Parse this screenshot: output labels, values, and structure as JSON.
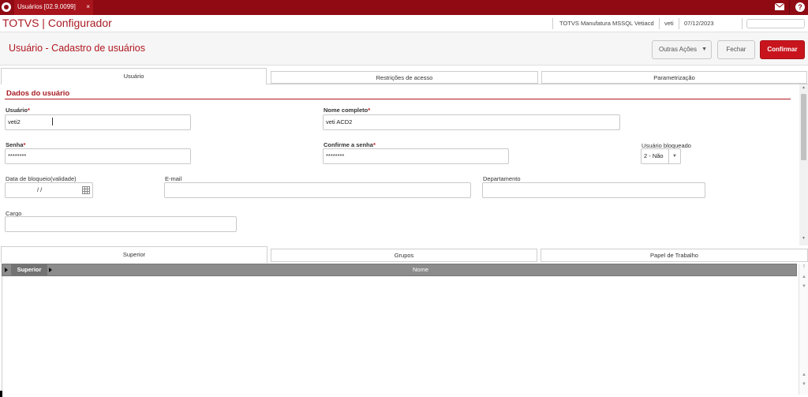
{
  "window": {
    "tab_title": "Usuários [02.9.0099]",
    "tab_close": "×",
    "help_label": "?"
  },
  "header": {
    "brand": "TOTVS | Configurador",
    "environment": "TOTVS Manufatura MSSQL Vetiacd",
    "user": "veti",
    "date": "07/12/2023",
    "search_value": ""
  },
  "page": {
    "title": "Usuário - Cadastro de usuários",
    "actions_label": "Outras Ações",
    "close_label": "Fechar",
    "confirm_label": "Confirmar"
  },
  "tabs": [
    {
      "label": "Usuário",
      "active": true
    },
    {
      "label": "Restrições de acesso",
      "active": false
    },
    {
      "label": "Parametrização",
      "active": false
    }
  ],
  "section": {
    "title": "Dados do usuário"
  },
  "fields": {
    "usuario": {
      "label": "Usuário",
      "required_mark": "*",
      "value": "veti2"
    },
    "nome": {
      "label": "Nome completo",
      "required_mark": "*",
      "value": "veti ACD2"
    },
    "senha": {
      "label": "Senha",
      "required_mark": "*",
      "value": "********"
    },
    "confirme": {
      "label": "Confirme a senha",
      "required_mark": "*",
      "value": "********"
    },
    "bloqueado": {
      "label": "Usuário bloqueado",
      "value": "2 - Não"
    },
    "data_bloqueio": {
      "label": "Data de bloqueio(validade)",
      "value": "/ /"
    },
    "email": {
      "label": "E-mail",
      "value": ""
    },
    "departamento": {
      "label": "Departamento",
      "value": ""
    },
    "cargo": {
      "label": "Cargo",
      "value": ""
    }
  },
  "lower_tabs": [
    {
      "label": "Superior",
      "active": true
    },
    {
      "label": "Grupos",
      "active": false
    },
    {
      "label": "Papel de Trabalho",
      "active": false
    }
  ],
  "grid": {
    "columns": [
      "Superior",
      "Nome"
    ],
    "rows": []
  },
  "colors": {
    "brand_red": "#8f0a13",
    "accent_red": "#b01820",
    "confirm_red": "#c8151d"
  }
}
